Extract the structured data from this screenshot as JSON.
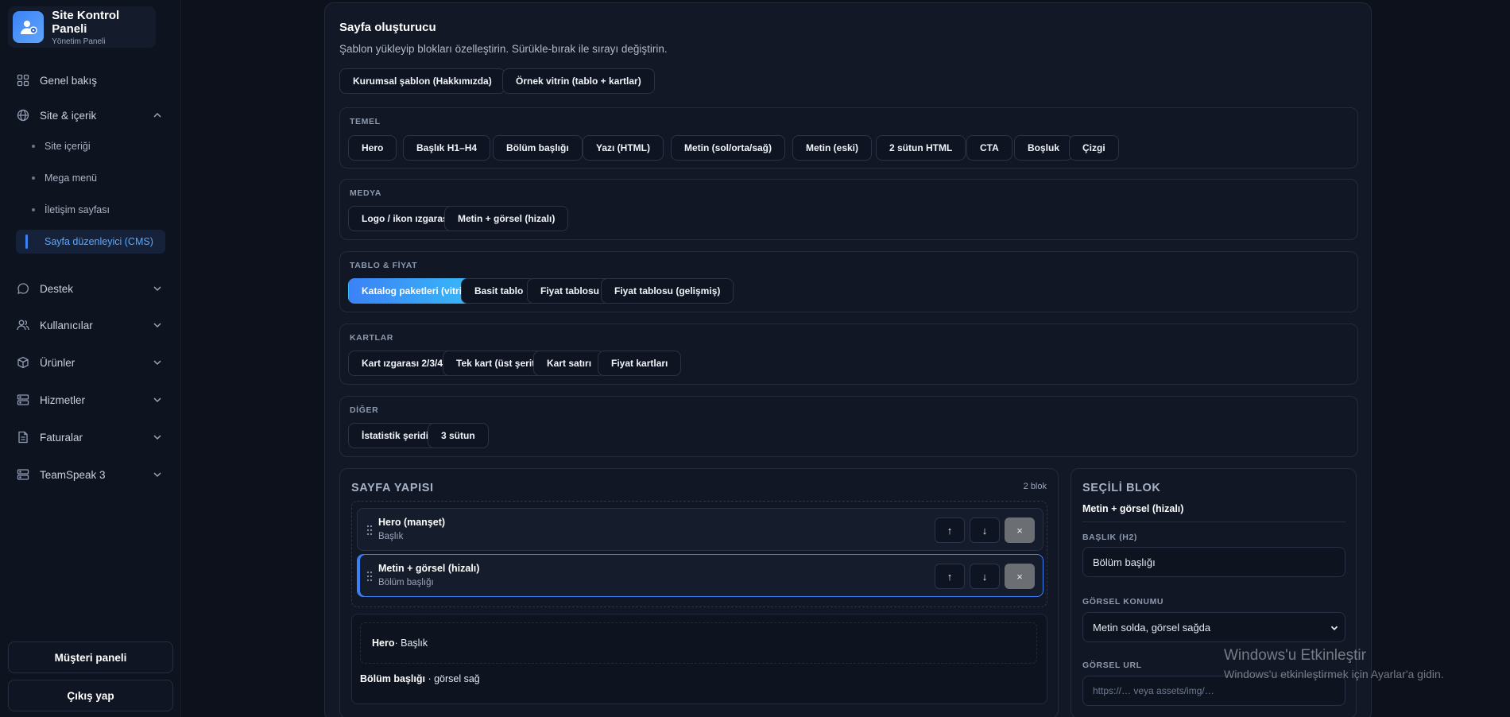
{
  "brand": {
    "title": "Site Kontrol Paneli",
    "subtitle": "Yönetim Paneli",
    "accent": "#3b82f6"
  },
  "sidebar": {
    "items": [
      {
        "label": "Genel bakış",
        "icon": "grid-icon"
      },
      {
        "label": "Site & içerik",
        "icon": "globe-icon",
        "expanded": true
      },
      {
        "label": "Destek",
        "icon": "chat-icon"
      },
      {
        "label": "Kullanıcılar",
        "icon": "users-icon"
      },
      {
        "label": "Ürünler",
        "icon": "box-icon"
      },
      {
        "label": "Hizmetler",
        "icon": "server-icon"
      },
      {
        "label": "Faturalar",
        "icon": "invoice-icon"
      },
      {
        "label": "TeamSpeak 3",
        "icon": "server-icon"
      }
    ],
    "subitems": [
      {
        "label": "Site içeriği"
      },
      {
        "label": "Mega menü"
      },
      {
        "label": "İletişim sayfası"
      },
      {
        "label": "Sayfa düzenleyici (CMS)",
        "active": true
      }
    ],
    "customer_panel": "Müşteri paneli",
    "logout": "Çıkış yap"
  },
  "builder": {
    "title": "Sayfa oluşturucu",
    "subtitle": "Şablon yükleyip blokları özelleştirin. Sürükle-bırak ile sırayı değiştirin.",
    "templates": [
      "Kurumsal şablon (Hakkımızda)",
      "Örnek vitrin (tablo + kartlar)"
    ],
    "sections": [
      {
        "label": "TEMEL",
        "buttons": [
          "Hero",
          "Başlık H1–H4",
          "Bölüm başlığı",
          "Yazı (HTML)",
          "Metin (sol/orta/sağ)",
          "Metin (eski)",
          "2 sütun HTML",
          "CTA",
          "Boşluk",
          "Çizgi"
        ]
      },
      {
        "label": "MEDYA",
        "buttons": [
          "Logo / ikon ızgarası",
          "Metin + görsel (hizalı)"
        ]
      },
      {
        "label": "TABLO & FİYAT",
        "buttons": [
          "Katalog paketleri (vitrin)",
          "Basit tablo",
          "Fiyat tablosu",
          "Fiyat tablosu (gelişmiş)"
        ],
        "active_index": 0
      },
      {
        "label": "KARTLAR",
        "buttons": [
          "Kart ızgarası 2/3/4",
          "Tek kart (üst şerit)",
          "Kart satırı",
          "Fiyat kartları"
        ]
      },
      {
        "label": "DİĞER",
        "buttons": [
          "İstatistik şeridi",
          "3 sütun"
        ]
      }
    ]
  },
  "structure": {
    "title": "SAYFA YAPISI",
    "count": "2 blok",
    "blocks": [
      {
        "title": "Hero (manşet)",
        "subtitle": "Başlık"
      },
      {
        "title": "Metin + görsel (hizalı)",
        "subtitle": "Bölüm başlığı",
        "selected": true
      }
    ],
    "preview": {
      "hero_bold": "Hero",
      "hero_rest": " · Başlık",
      "line_bold": "Bölüm başlığı",
      "line_rest": " · görsel sağ"
    }
  },
  "selected": {
    "title": "SEÇİLİ BLOK",
    "block_name": "Metin + görsel (hizalı)",
    "heading_label": "BAŞLIK (H2)",
    "heading_value": "Bölüm başlığı",
    "position_label": "GÖRSEL KONUMU",
    "position_value": "Metin solda, görsel sağda",
    "url_label": "GÖRSEL URL",
    "url_placeholder": "https://… veya assets/img/…"
  },
  "watermark": {
    "title": "Windows'u Etkinleştir",
    "subtitle": "Windows'u etkinleştirmek için Ayarlar'a gidin."
  }
}
